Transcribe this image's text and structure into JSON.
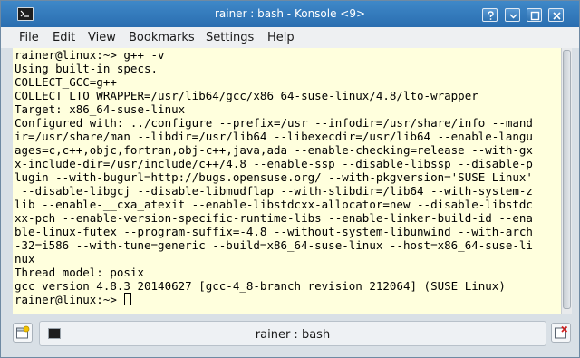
{
  "window": {
    "title": "rainer : bash - Konsole <9>"
  },
  "menu": [
    "File",
    "Edit",
    "View",
    "Bookmarks",
    "Settings",
    "Help"
  ],
  "terminal": {
    "lines": [
      "rainer@linux:~> g++ -v",
      "Using built-in specs.",
      "COLLECT_GCC=g++",
      "COLLECT_LTO_WRAPPER=/usr/lib64/gcc/x86_64-suse-linux/4.8/lto-wrapper",
      "Target: x86_64-suse-linux",
      "Configured with: ../configure --prefix=/usr --infodir=/usr/share/info --mand",
      "ir=/usr/share/man --libdir=/usr/lib64 --libexecdir=/usr/lib64 --enable-langu",
      "ages=c,c++,objc,fortran,obj-c++,java,ada --enable-checking=release --with-gx",
      "x-include-dir=/usr/include/c++/4.8 --enable-ssp --disable-libssp --disable-p",
      "lugin --with-bugurl=http://bugs.opensuse.org/ --with-pkgversion='SUSE Linux'",
      " --disable-libgcj --disable-libmudflap --with-slibdir=/lib64 --with-system-z",
      "lib --enable-__cxa_atexit --enable-libstdcxx-allocator=new --disable-libstdc",
      "xx-pch --enable-version-specific-runtime-libs --enable-linker-build-id --ena",
      "ble-linux-futex --program-suffix=-4.8 --without-system-libunwind --with-arch",
      "-32=i586 --with-tune=generic --build=x86_64-suse-linux --host=x86_64-suse-li",
      "nux",
      "Thread model: posix",
      "gcc version 4.8.3 20140627 [gcc-4_8-branch revision 212064] (SUSE Linux)"
    ],
    "prompt": "rainer@linux:~> "
  },
  "tabs": [
    {
      "label": "rainer : bash"
    }
  ],
  "icons": {
    "app": "terminal-icon",
    "help": "help-icon",
    "minimize": "minimize-icon",
    "maximize": "maximize-icon",
    "close": "close-icon",
    "new_tab": "new-tab-icon",
    "close_tab": "close-tab-icon"
  },
  "colors": {
    "titlebar": "#2e74b6",
    "terminal_bg": "#ffffdd",
    "terminal_fg": "#000000"
  }
}
